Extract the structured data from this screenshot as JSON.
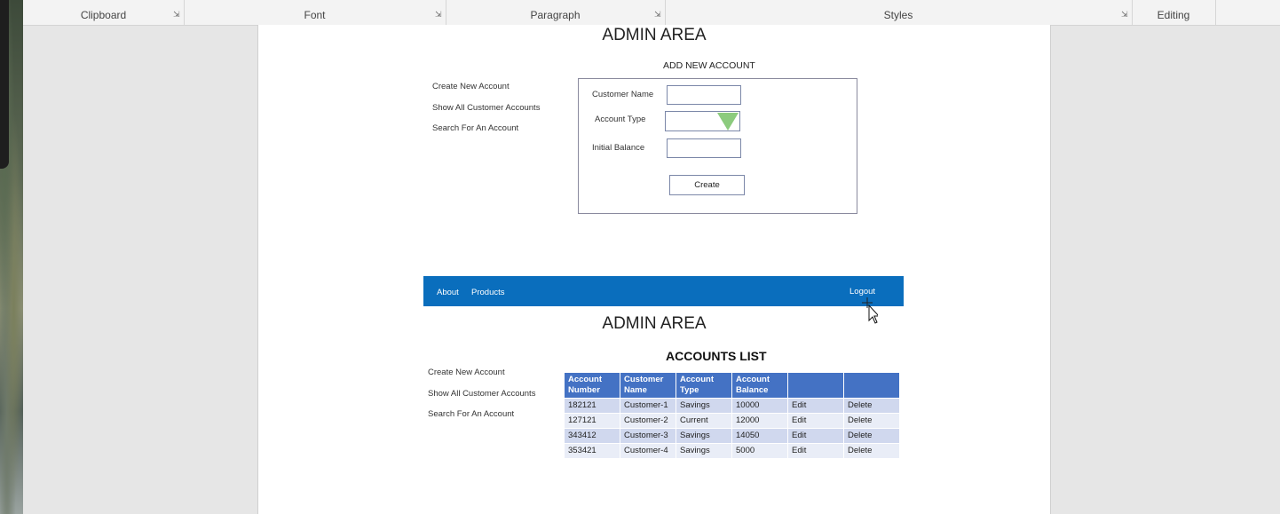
{
  "ribbon": {
    "groups": [
      {
        "label": "Clipboard"
      },
      {
        "label": "Font"
      },
      {
        "label": "Paragraph"
      },
      {
        "label": "Styles"
      },
      {
        "label": "Editing"
      }
    ]
  },
  "form_screen": {
    "heading": "ADMIN AREA",
    "side_links": [
      "Create New Account",
      "Show All Customer Accounts",
      "Search For An Account"
    ],
    "form_title": "ADD NEW ACCOUNT",
    "fields": {
      "customer_name_label": "Customer Name",
      "account_type_label": "Account Type",
      "initial_balance_label": "Initial Balance"
    },
    "create_label": "Create"
  },
  "list_screen": {
    "nav": {
      "about": "About",
      "products": "Products",
      "logout": "Logout"
    },
    "heading": "ADMIN AREA",
    "side_links": [
      "Create New Account",
      "Show All Customer Accounts",
      "Search For An Account"
    ],
    "list_title": "ACCOUNTS LIST",
    "columns": [
      "Account Number",
      "Customer Name",
      "Account Type",
      "Account Balance",
      "",
      ""
    ],
    "rows": [
      [
        "182121",
        "Customer-1",
        "Savings",
        "10000",
        "Edit",
        "Delete"
      ],
      [
        "127121",
        "Customer-2",
        "Current",
        "12000",
        "Edit",
        "Delete"
      ],
      [
        "343412",
        "Customer-3",
        "Savings",
        "14050",
        "Edit",
        "Delete"
      ],
      [
        "353421",
        "Customer-4",
        "Savings",
        "5000",
        "Edit",
        "Delete"
      ]
    ]
  },
  "colors": {
    "navbar": "#0a6ebd",
    "table_header": "#4472c4",
    "row_odd": "#d0d8ee",
    "row_even": "#e9edf7",
    "dropdown_arrow": "#8ccb7e"
  },
  "icons": [
    "dialog-launcher-icon",
    "dropdown-arrow-icon",
    "mouse-cursor-icon"
  ]
}
